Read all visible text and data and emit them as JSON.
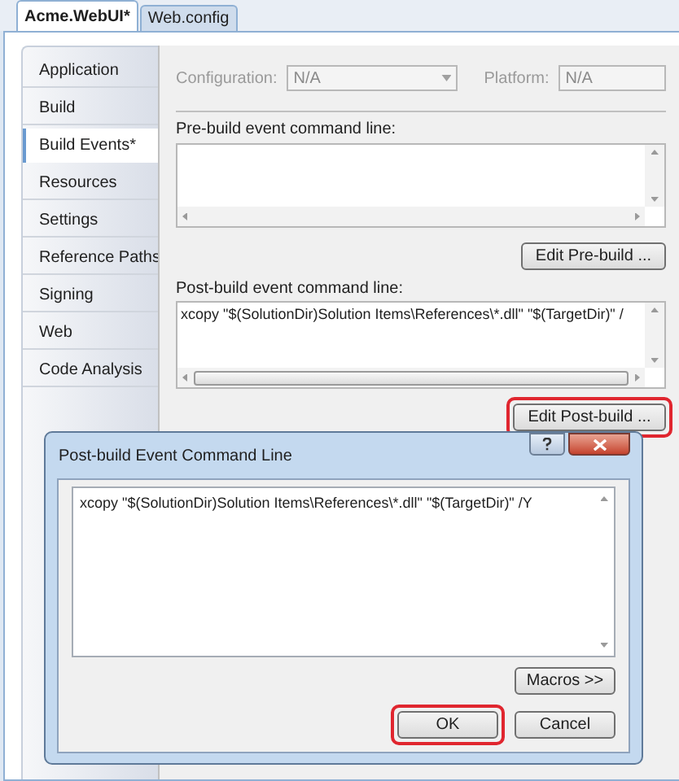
{
  "tabs": [
    {
      "label": "Acme.WebUI*",
      "selected": true
    },
    {
      "label": "Web.config",
      "selected": false
    }
  ],
  "sidebar": {
    "items": [
      {
        "label": "Application",
        "selected": false
      },
      {
        "label": "Build",
        "selected": false
      },
      {
        "label": "Build Events*",
        "selected": true
      },
      {
        "label": "Resources",
        "selected": false
      },
      {
        "label": "Settings",
        "selected": false
      },
      {
        "label": "Reference Paths",
        "selected": false
      },
      {
        "label": "Signing",
        "selected": false
      },
      {
        "label": "Web",
        "selected": false
      },
      {
        "label": "Code Analysis",
        "selected": false
      }
    ]
  },
  "configuration": {
    "label": "Configuration:",
    "value": "N/A",
    "disabled": true
  },
  "platform": {
    "label": "Platform:",
    "value": "N/A",
    "disabled": true
  },
  "pre_build": {
    "label": "Pre-build event command line:",
    "button": {
      "label": "Edit Pre-build ...",
      "highlighted": false
    }
  },
  "post_build": {
    "label": "Post-build event command line:",
    "value": "xcopy \"$(SolutionDir)Solution Items\\References\\*.dll\" \"$(TargetDir)\" /",
    "button": {
      "label": "Edit Post-build ...",
      "highlighted": true
    }
  },
  "dialog": {
    "title": "Post-build Event Command Line",
    "value": "xcopy \"$(SolutionDir)Solution Items\\References\\*.dll\" \"$(TargetDir)\" /Y",
    "buttons": [
      {
        "label": "Macros >>",
        "highlighted": false
      },
      {
        "label": "OK",
        "highlighted": true
      },
      {
        "label": "Cancel",
        "highlighted": false
      }
    ]
  }
}
